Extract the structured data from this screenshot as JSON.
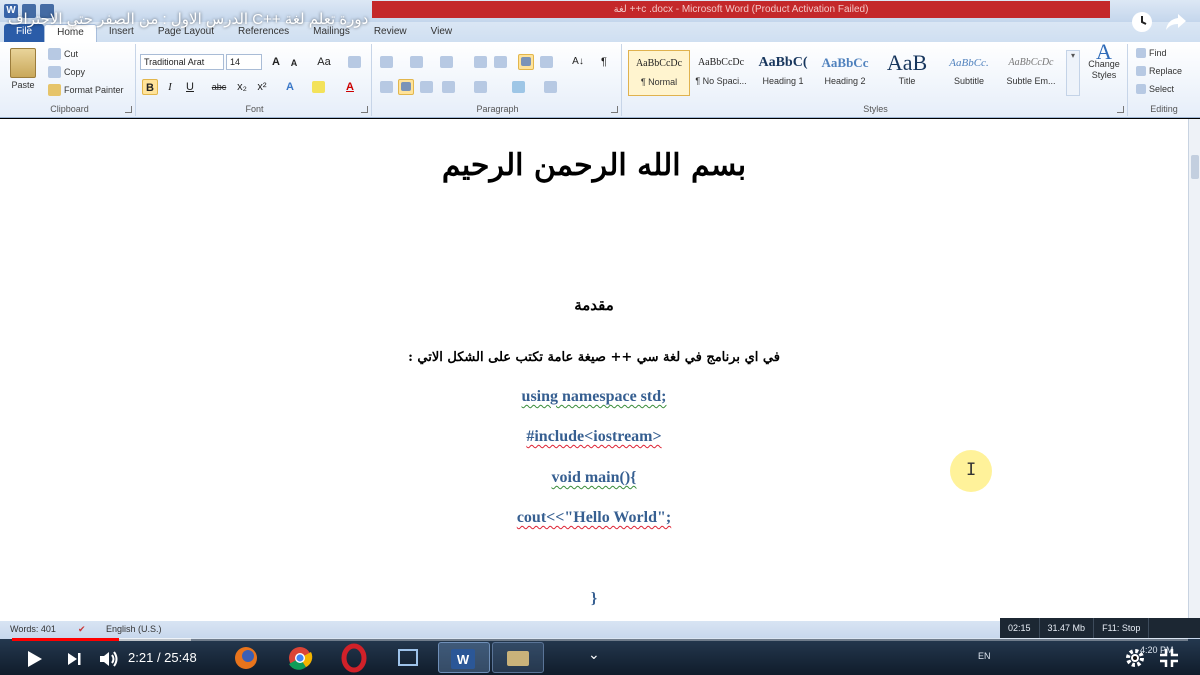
{
  "video": {
    "title": "دورة تعلم لغة ++C الدرس الاول : من الصفر حتي الاحتراف",
    "current_time": "2:21",
    "duration": "25:48",
    "progress_fraction": 0.091,
    "buffer_fraction": 0.152,
    "accent": "#ff0000"
  },
  "word": {
    "window_title": "لغة ++c .docx - Microsoft Word (Product Activation Failed)",
    "tabs": [
      "File",
      "Home",
      "Insert",
      "Page Layout",
      "References",
      "Mailings",
      "Review",
      "View"
    ],
    "active_tab": "Home",
    "clipboard": {
      "paste": "Paste",
      "cut": "Cut",
      "copy": "Copy",
      "format_painter": "Format Painter",
      "label": "Clipboard"
    },
    "font": {
      "family": "Traditional Arat",
      "size": "14",
      "grow": "A",
      "shrink": "A",
      "change_case": "Aa",
      "bold": "B",
      "italic": "I",
      "underline": "U",
      "strike": "abc",
      "subscript": "x₂",
      "superscript": "x²",
      "text_effects": "A",
      "font_color": "A",
      "label": "Font"
    },
    "paragraph": {
      "sort": "A↓",
      "show_marks": "¶",
      "label": "Paragraph"
    },
    "styles": {
      "items": [
        {
          "preview": "AaBbCcDc",
          "name": "¶ Normal"
        },
        {
          "preview": "AaBbCcDc",
          "name": "¶ No Spaci..."
        },
        {
          "preview": "AaBbC(",
          "name": "Heading 1"
        },
        {
          "preview": "AaBbCc",
          "name": "Heading 2"
        },
        {
          "preview": "AaB",
          "name": "Title"
        },
        {
          "preview": "AaBbCc.",
          "name": "Subtitle"
        },
        {
          "preview": "AaBbCcDc",
          "name": "Subtle Em..."
        }
      ],
      "change_styles": "Change Styles",
      "label": "Styles"
    },
    "editing": {
      "find": "Find",
      "replace": "Replace",
      "select": "Select",
      "label": "Editing"
    },
    "document": {
      "basmala": "بسم الله الرحمن الرحيم",
      "heading": "مقدمة",
      "intro": "في اي برنامج في لغة سي ++ صيغة عامة تكتب على الشكل الاتي :",
      "code_1": "using namespace std;",
      "code_2": "#include<iostream>",
      "code_3": "void main(){",
      "code_4": "cout<<\"Hello World\";",
      "code_5": "}"
    },
    "status": {
      "words": "Words: 401",
      "language": "English (U.S.)"
    }
  },
  "recorder": {
    "time": "02:15",
    "size": "31.47 Mb",
    "stop": "F11: Stop"
  },
  "taskbar": {
    "lang": "EN",
    "clock": "4:20 PM"
  }
}
